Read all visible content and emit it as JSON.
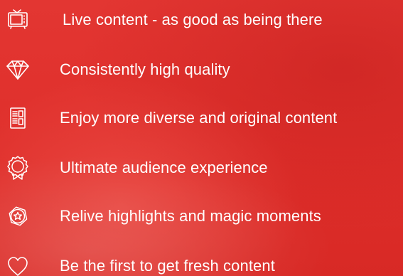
{
  "features": [
    {
      "label": "Live content - as good as being there",
      "icon": "tv-icon"
    },
    {
      "label": "Consistently high quality",
      "icon": "diamond-icon"
    },
    {
      "label": "Enjoy more diverse and original content",
      "icon": "document-icon"
    },
    {
      "label": "Ultimate audience experience",
      "icon": "award-ribbon-icon"
    },
    {
      "label": "Relive highlights and magic moments",
      "icon": "star-badge-icon"
    },
    {
      "label": "Be the first to get fresh content",
      "icon": "heart-icon"
    }
  ],
  "colors": {
    "background": "#e2312e",
    "text": "#ffffff",
    "icon_stroke": "#ffffff"
  }
}
